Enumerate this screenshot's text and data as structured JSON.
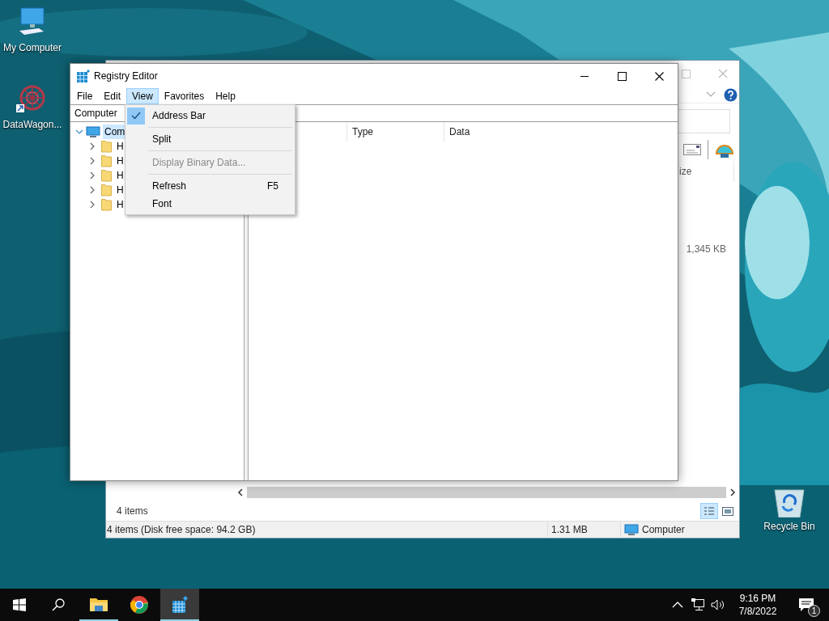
{
  "desktop_icons": [
    {
      "label": "My Computer",
      "kind": "computer"
    },
    {
      "label": "DataWagon...",
      "kind": "shortcut"
    },
    {
      "label": "Recycle Bin",
      "kind": "bin"
    }
  ],
  "explorer": {
    "column_heading": "ize",
    "size": "1,345 KB",
    "item_count": "4 items",
    "status": {
      "summary": "4 items (Disk free space: 94.2 GB)",
      "selection_size": "1.31 MB",
      "location": "Computer"
    }
  },
  "regedit": {
    "title": "Registry Editor",
    "menu": [
      {
        "label": "File",
        "selected": false
      },
      {
        "label": "Edit",
        "selected": false
      },
      {
        "label": "View",
        "selected": true
      },
      {
        "label": "Favorites",
        "selected": false
      },
      {
        "label": "Help",
        "selected": false
      }
    ],
    "address": "Computer",
    "tree": {
      "label": "Com",
      "expanded": true,
      "selected": true,
      "children": [
        {
          "label": "H",
          "expanded": false,
          "selected": false
        },
        {
          "label": "H",
          "expanded": false,
          "selected": false
        },
        {
          "label": "H",
          "expanded": false,
          "selected": false
        },
        {
          "label": "H",
          "expanded": false,
          "selected": false
        },
        {
          "label": "H",
          "expanded": false,
          "selected": false
        }
      ]
    },
    "columns": [
      "Type",
      "Data"
    ],
    "view_menu": [
      {
        "kind": "item",
        "label": "Address Bar",
        "checked": true,
        "disabled": false
      },
      {
        "kind": "separator"
      },
      {
        "kind": "item",
        "label": "Split",
        "checked": false,
        "disabled": false
      },
      {
        "kind": "separator"
      },
      {
        "kind": "item",
        "label": "Display Binary Data...",
        "checked": false,
        "disabled": true
      },
      {
        "kind": "separator"
      },
      {
        "kind": "item",
        "label": "Refresh",
        "shortcut": "F5",
        "checked": false,
        "disabled": false
      },
      {
        "kind": "item",
        "label": "Font",
        "checked": false,
        "disabled": false
      }
    ]
  },
  "taskbar": {
    "apps": [
      {
        "kind": "explorer",
        "running": true,
        "selected": false
      },
      {
        "kind": "chrome",
        "running": false,
        "selected": false
      },
      {
        "kind": "regedit",
        "running": true,
        "selected": true
      }
    ],
    "clock": {
      "time": "9:16 PM",
      "date": "7/8/2022"
    },
    "notifications": "1"
  }
}
